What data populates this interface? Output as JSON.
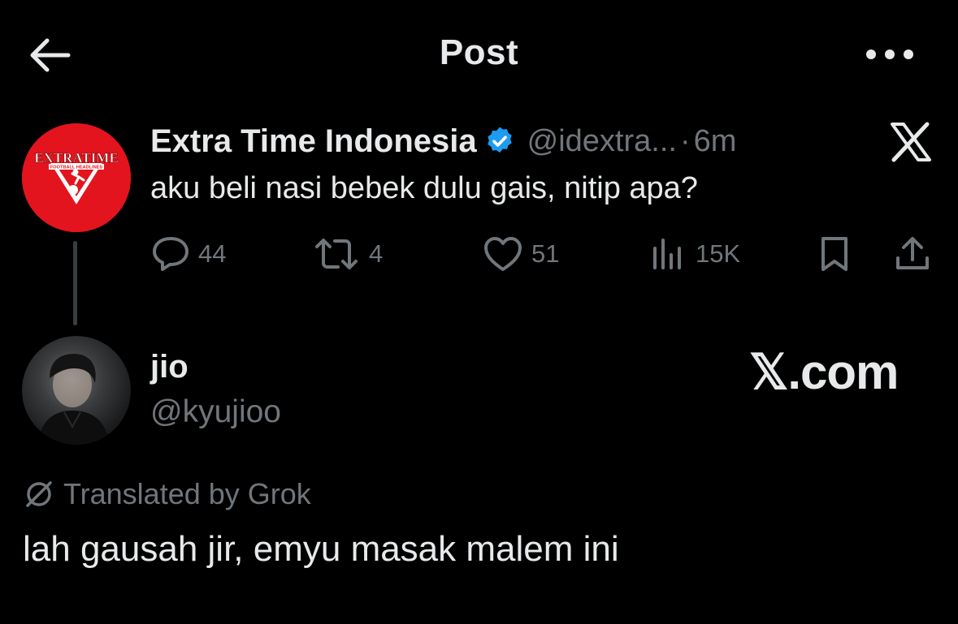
{
  "header": {
    "title": "Post",
    "back_icon": "arrow-left-icon",
    "more_icon": "more-horizontal-icon"
  },
  "tweet": {
    "author": {
      "name": "Extra Time Indonesia",
      "handle": "@idextra...",
      "verified": true,
      "verified_color": "#1d9bf0",
      "avatar_color": "#e3141d",
      "logo_text": "EXTRATIME",
      "logo_subtext": "FOOTBALL HEADLINES"
    },
    "separator": "·",
    "time": "6m",
    "text": "aku beli nasi bebek dulu gais, nitip apa?",
    "stats": {
      "replies": "44",
      "reposts": "4",
      "likes": "51",
      "views": "15K"
    }
  },
  "reply": {
    "name": "jio",
    "handle": "@kyujioo",
    "translated_label": "Translated by Grok",
    "text": "lah gausah jir, emyu masak malem ini"
  },
  "watermark": "𝕏.com",
  "colors": {
    "background": "#000000",
    "text_primary": "#e7e9ea",
    "text_secondary": "#71767b"
  }
}
